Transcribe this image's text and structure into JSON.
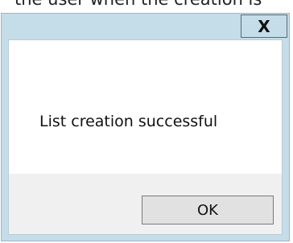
{
  "background_text": "the user when the creation is",
  "dialog": {
    "close_label": "X",
    "message": "List creation successful",
    "ok_label": "OK"
  }
}
